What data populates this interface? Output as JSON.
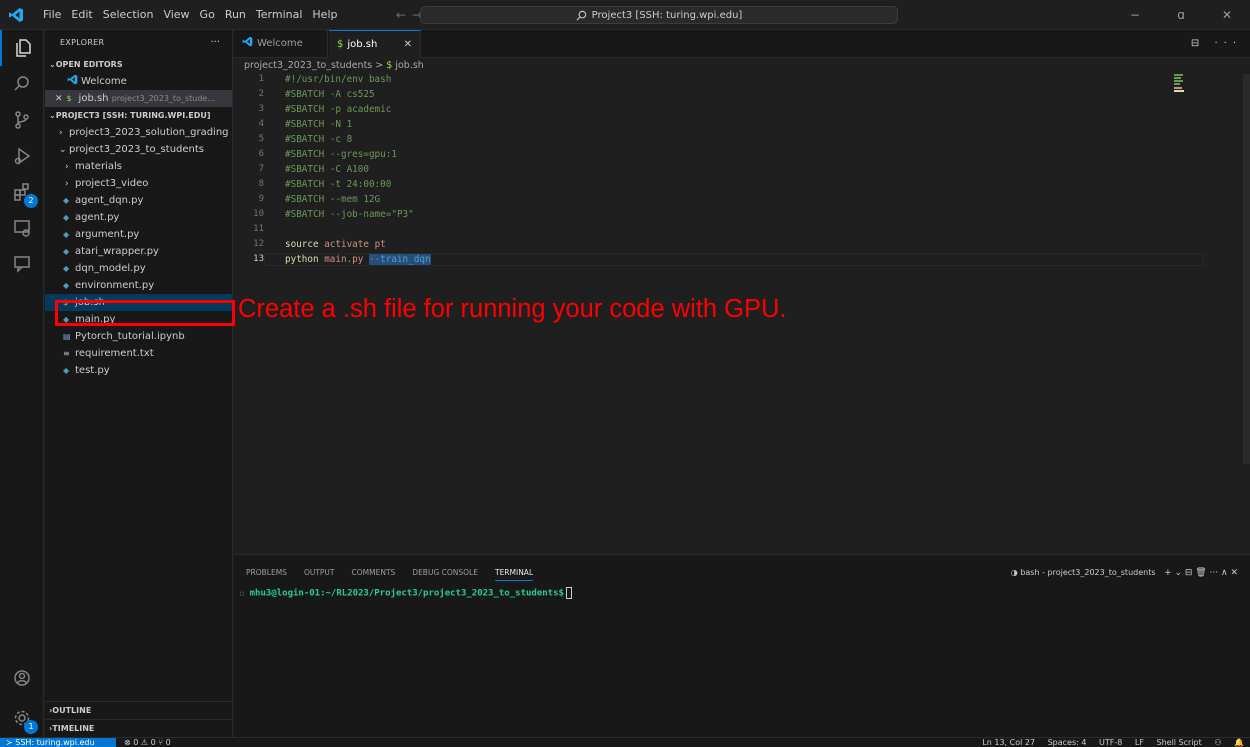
{
  "menu": [
    "File",
    "Edit",
    "Selection",
    "View",
    "Go",
    "Run",
    "Terminal",
    "Help"
  ],
  "command_center": "Project3 [SSH: turing.wpi.edu]",
  "window_controls": [
    "−",
    "ɑ",
    "✕"
  ],
  "activity_badges": {
    "extensions": "2",
    "accounts": "1"
  },
  "sidebar": {
    "title": "EXPLORER",
    "more": "···",
    "open_editors": {
      "header": "OPEN EDITORS",
      "items": [
        {
          "name": "Welcome",
          "detail": ""
        },
        {
          "close": "✕",
          "name": "job.sh",
          "detail": "project3_2023_to_stude..."
        }
      ]
    },
    "project": {
      "header": "PROJECT3 [SSH: TURING.WPI.EDU]",
      "folders": [
        "project3_2023_solution_grading",
        "project3_2023_to_students",
        "materials",
        "project3_video"
      ],
      "files": [
        "agent_dqn.py",
        "agent.py",
        "argument.py",
        "atari_wrapper.py",
        "dqn_model.py",
        "environment.py",
        "job.sh",
        "main.py",
        "Pytorch_tutorial.ipynb",
        "requirement.txt",
        "test.py"
      ]
    },
    "outline": "OUTLINE",
    "timeline": "TIMELINE"
  },
  "tabs": {
    "welcome": "Welcome",
    "job": "job.sh",
    "close": "✕"
  },
  "editor_actions": "⊟ ···",
  "breadcrumb": {
    "folder": "project3_2023_to_students",
    "sep": ">",
    "file": "job.sh"
  },
  "code": {
    "line_numbers": [
      "1",
      "2",
      "3",
      "4",
      "5",
      "6",
      "7",
      "8",
      "9",
      "10",
      "11",
      "12",
      "13"
    ],
    "lines": [
      "#!/usr/bin/env bash",
      "#SBATCH -A cs525",
      "#SBATCH -p academic",
      "#SBATCH -N 1",
      "#SBATCH -c 8",
      "#SBATCH --gres=gpu:1",
      "#SBATCH -C A100",
      "#SBATCH -t 24:00:00",
      "#SBATCH --mem 12G",
      "#SBATCH --job-name=\"P3\"",
      "",
      "source activate pt",
      "python main.py --train_dqn"
    ],
    "l12": {
      "kw": "source",
      "rest": " activate pt"
    },
    "l13": {
      "kw": "python",
      "rest": " main.py ",
      "flag": "--train_dqn"
    }
  },
  "annotation": "Create a .sh file for running your code with GPU.",
  "panel": {
    "tabs": [
      "PROBLEMS",
      "OUTPUT",
      "COMMENTS",
      "DEBUG CONSOLE",
      "TERMINAL"
    ],
    "terminal_name": "bash - project3_2023_to_students",
    "terminal_actions": "+ ⌄ ⊟ 🗑 ··· ∧ ✕",
    "prompt": "mhu3@login-01:~/RL2023/Project3/project3_2023_to_students$"
  },
  "statusbar": {
    "remote": "SSH: turing.wpi.edu",
    "errors": "⊗ 0 ⚠ 0   ⑂ 0",
    "position": "Ln 13, Col 27",
    "spaces": "Spaces: 4",
    "encoding": "UTF-8",
    "eol": "LF",
    "language": "Shell Script"
  }
}
